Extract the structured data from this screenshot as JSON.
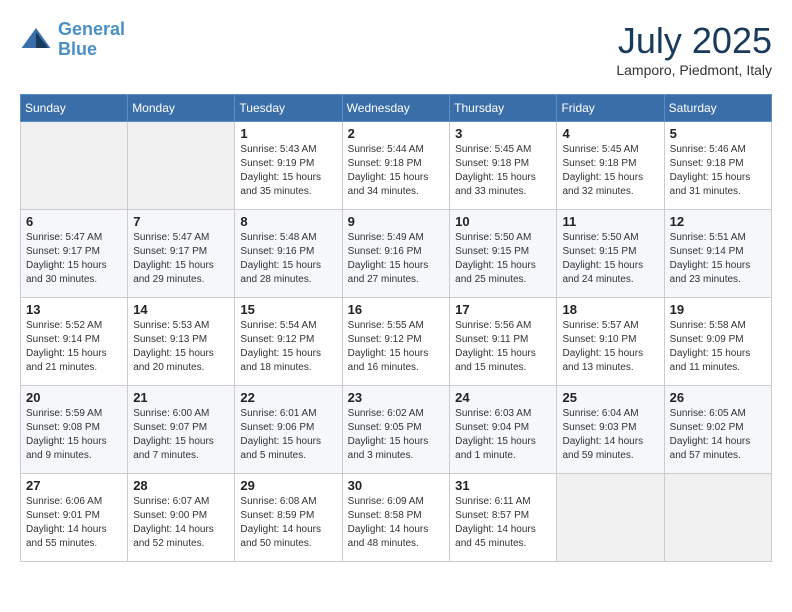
{
  "header": {
    "logo_line1": "General",
    "logo_line2": "Blue",
    "month": "July 2025",
    "location": "Lamporo, Piedmont, Italy"
  },
  "days_of_week": [
    "Sunday",
    "Monday",
    "Tuesday",
    "Wednesday",
    "Thursday",
    "Friday",
    "Saturday"
  ],
  "weeks": [
    [
      {
        "day": "",
        "info": ""
      },
      {
        "day": "",
        "info": ""
      },
      {
        "day": "1",
        "info": "Sunrise: 5:43 AM\nSunset: 9:19 PM\nDaylight: 15 hours\nand 35 minutes."
      },
      {
        "day": "2",
        "info": "Sunrise: 5:44 AM\nSunset: 9:18 PM\nDaylight: 15 hours\nand 34 minutes."
      },
      {
        "day": "3",
        "info": "Sunrise: 5:45 AM\nSunset: 9:18 PM\nDaylight: 15 hours\nand 33 minutes."
      },
      {
        "day": "4",
        "info": "Sunrise: 5:45 AM\nSunset: 9:18 PM\nDaylight: 15 hours\nand 32 minutes."
      },
      {
        "day": "5",
        "info": "Sunrise: 5:46 AM\nSunset: 9:18 PM\nDaylight: 15 hours\nand 31 minutes."
      }
    ],
    [
      {
        "day": "6",
        "info": "Sunrise: 5:47 AM\nSunset: 9:17 PM\nDaylight: 15 hours\nand 30 minutes."
      },
      {
        "day": "7",
        "info": "Sunrise: 5:47 AM\nSunset: 9:17 PM\nDaylight: 15 hours\nand 29 minutes."
      },
      {
        "day": "8",
        "info": "Sunrise: 5:48 AM\nSunset: 9:16 PM\nDaylight: 15 hours\nand 28 minutes."
      },
      {
        "day": "9",
        "info": "Sunrise: 5:49 AM\nSunset: 9:16 PM\nDaylight: 15 hours\nand 27 minutes."
      },
      {
        "day": "10",
        "info": "Sunrise: 5:50 AM\nSunset: 9:15 PM\nDaylight: 15 hours\nand 25 minutes."
      },
      {
        "day": "11",
        "info": "Sunrise: 5:50 AM\nSunset: 9:15 PM\nDaylight: 15 hours\nand 24 minutes."
      },
      {
        "day": "12",
        "info": "Sunrise: 5:51 AM\nSunset: 9:14 PM\nDaylight: 15 hours\nand 23 minutes."
      }
    ],
    [
      {
        "day": "13",
        "info": "Sunrise: 5:52 AM\nSunset: 9:14 PM\nDaylight: 15 hours\nand 21 minutes."
      },
      {
        "day": "14",
        "info": "Sunrise: 5:53 AM\nSunset: 9:13 PM\nDaylight: 15 hours\nand 20 minutes."
      },
      {
        "day": "15",
        "info": "Sunrise: 5:54 AM\nSunset: 9:12 PM\nDaylight: 15 hours\nand 18 minutes."
      },
      {
        "day": "16",
        "info": "Sunrise: 5:55 AM\nSunset: 9:12 PM\nDaylight: 15 hours\nand 16 minutes."
      },
      {
        "day": "17",
        "info": "Sunrise: 5:56 AM\nSunset: 9:11 PM\nDaylight: 15 hours\nand 15 minutes."
      },
      {
        "day": "18",
        "info": "Sunrise: 5:57 AM\nSunset: 9:10 PM\nDaylight: 15 hours\nand 13 minutes."
      },
      {
        "day": "19",
        "info": "Sunrise: 5:58 AM\nSunset: 9:09 PM\nDaylight: 15 hours\nand 11 minutes."
      }
    ],
    [
      {
        "day": "20",
        "info": "Sunrise: 5:59 AM\nSunset: 9:08 PM\nDaylight: 15 hours\nand 9 minutes."
      },
      {
        "day": "21",
        "info": "Sunrise: 6:00 AM\nSunset: 9:07 PM\nDaylight: 15 hours\nand 7 minutes."
      },
      {
        "day": "22",
        "info": "Sunrise: 6:01 AM\nSunset: 9:06 PM\nDaylight: 15 hours\nand 5 minutes."
      },
      {
        "day": "23",
        "info": "Sunrise: 6:02 AM\nSunset: 9:05 PM\nDaylight: 15 hours\nand 3 minutes."
      },
      {
        "day": "24",
        "info": "Sunrise: 6:03 AM\nSunset: 9:04 PM\nDaylight: 15 hours\nand 1 minute."
      },
      {
        "day": "25",
        "info": "Sunrise: 6:04 AM\nSunset: 9:03 PM\nDaylight: 14 hours\nand 59 minutes."
      },
      {
        "day": "26",
        "info": "Sunrise: 6:05 AM\nSunset: 9:02 PM\nDaylight: 14 hours\nand 57 minutes."
      }
    ],
    [
      {
        "day": "27",
        "info": "Sunrise: 6:06 AM\nSunset: 9:01 PM\nDaylight: 14 hours\nand 55 minutes."
      },
      {
        "day": "28",
        "info": "Sunrise: 6:07 AM\nSunset: 9:00 PM\nDaylight: 14 hours\nand 52 minutes."
      },
      {
        "day": "29",
        "info": "Sunrise: 6:08 AM\nSunset: 8:59 PM\nDaylight: 14 hours\nand 50 minutes."
      },
      {
        "day": "30",
        "info": "Sunrise: 6:09 AM\nSunset: 8:58 PM\nDaylight: 14 hours\nand 48 minutes."
      },
      {
        "day": "31",
        "info": "Sunrise: 6:11 AM\nSunset: 8:57 PM\nDaylight: 14 hours\nand 45 minutes."
      },
      {
        "day": "",
        "info": ""
      },
      {
        "day": "",
        "info": ""
      }
    ]
  ]
}
